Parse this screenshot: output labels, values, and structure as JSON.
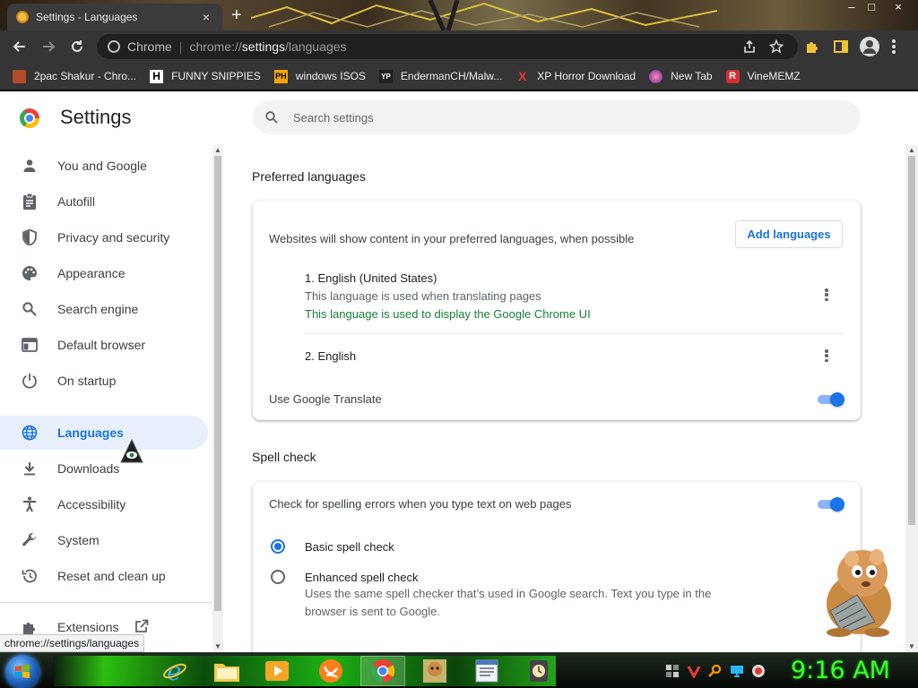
{
  "tab": {
    "title": "Settings - Languages",
    "close": "×",
    "new_tab": "+"
  },
  "window_controls": {
    "minimize": "–",
    "maximize": "□",
    "close": "×"
  },
  "omnibox": {
    "site_label": "Chrome",
    "url_scheme": "chrome://",
    "url_host": "settings",
    "url_path": "/languages"
  },
  "bookmarks": [
    {
      "label": "2pac Shakur - Chro...",
      "icon": "2pac-favicon",
      "color": "#b34a2a"
    },
    {
      "label": "FUNNY SNIPPIES",
      "icon": "H-favicon",
      "glyph": "H",
      "color": "#ffffff"
    },
    {
      "label": "windows ISOS",
      "icon": "PH-favicon",
      "glyph": "PH",
      "color": "#f7a500"
    },
    {
      "label": "EndermanCH/Malw...",
      "icon": "YP-favicon",
      "glyph": "YP",
      "color": "#333333"
    },
    {
      "label": "XP Horror Download",
      "icon": "x-favicon",
      "glyph": "X",
      "color": "#e53935"
    },
    {
      "label": "New Tab",
      "icon": "newtab-favicon",
      "color": "#c2185b"
    },
    {
      "label": "VineMEMZ",
      "icon": "R-favicon",
      "glyph": "R",
      "color": "#d32f2f"
    }
  ],
  "settings": {
    "title": "Settings",
    "search_placeholder": "Search settings"
  },
  "sidebar": {
    "items": [
      {
        "label": "You and Google",
        "icon": "person-icon"
      },
      {
        "label": "Autofill",
        "icon": "clipboard-icon"
      },
      {
        "label": "Privacy and security",
        "icon": "shield-icon"
      },
      {
        "label": "Appearance",
        "icon": "palette-icon"
      },
      {
        "label": "Search engine",
        "icon": "search-icon"
      },
      {
        "label": "Default browser",
        "icon": "browser-window-icon"
      },
      {
        "label": "On startup",
        "icon": "power-icon"
      },
      {
        "label": "Languages",
        "icon": "globe-icon",
        "active": true
      },
      {
        "label": "Downloads",
        "icon": "download-icon"
      },
      {
        "label": "Accessibility",
        "icon": "accessibility-icon"
      },
      {
        "label": "System",
        "icon": "wrench-icon"
      },
      {
        "label": "Reset and clean up",
        "icon": "history-icon"
      }
    ],
    "extensions_label": "Extensions"
  },
  "preferred_languages": {
    "section_title": "Preferred languages",
    "description": "Websites will show content in your preferred languages, when possible",
    "add_button": "Add languages",
    "languages": [
      {
        "name": "1. English (United States)",
        "subtitle": "This language is used when translating pages",
        "note": "This language is used to display the Google Chrome UI"
      },
      {
        "name": "2. English"
      }
    ],
    "translate_label": "Use Google Translate",
    "translate_enabled": true
  },
  "spell_check": {
    "section_title": "Spell check",
    "check_label": "Check for spelling errors when you type text on web pages",
    "check_enabled": true,
    "options": [
      {
        "label": "Basic spell check",
        "selected": true
      },
      {
        "label": "Enhanced spell check",
        "description": "Uses the same spell checker that’s used in Google search. Text you type in the browser is sent to Google.",
        "selected": false
      }
    ]
  },
  "status_bar": {
    "url": "chrome://settings/languages"
  },
  "taskbar": {
    "apps": [
      "internet-explorer",
      "file-explorer",
      "media-player",
      "uc-browser",
      "chrome",
      "hamster-box",
      "notepad",
      "clock-app"
    ],
    "clock": "9:16 AM"
  },
  "colors": {
    "accent": "#1a73e8",
    "active_nav_bg": "#e8f0fe",
    "green_note": "#188038",
    "toolbar_bg": "#353535",
    "clock_green": "#3bff2b"
  }
}
